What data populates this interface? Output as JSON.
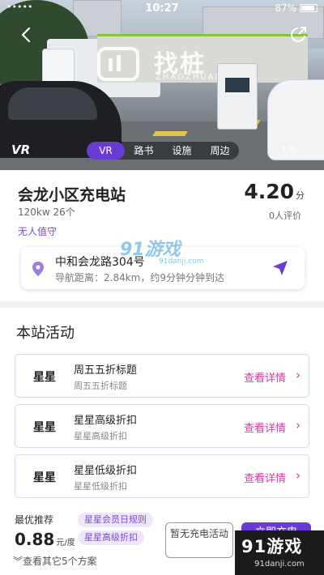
{
  "status_bar": {
    "carrier": "•••••",
    "time": "10:27",
    "battery": "87%"
  },
  "hero": {
    "banner_text": "找桩",
    "banner_sub": "ZHAOZHUANG",
    "vr_logo": "VR",
    "tabs": [
      {
        "label": "VR",
        "active": true
      },
      {
        "label": "路书",
        "active": false
      },
      {
        "label": "设施",
        "active": false
      },
      {
        "label": "周边",
        "active": false
      }
    ],
    "photo_count": "1/6",
    "icons": {
      "back": "back-arrow-icon",
      "share": "share-icon"
    }
  },
  "station": {
    "name": "会龙小区充电站",
    "spec": "120kw 26个",
    "tag": "无人值守",
    "score": "4.20",
    "score_unit": "分",
    "rating_count": "0人评价",
    "address": "中和会龙路304号",
    "nav_info": "导航距离：2.84km，约9分钟分钟到达"
  },
  "watermark": {
    "main": "91游戏",
    "sub": "91danji.com"
  },
  "activities": {
    "title": "本站活动",
    "items": [
      {
        "store": "星星",
        "title": "周五五折标题",
        "subtitle": "周五五折标题",
        "link": "查看详情"
      },
      {
        "store": "星星",
        "title": "星星高级折扣",
        "subtitle": "星星高级折扣",
        "link": "查看详情"
      },
      {
        "store": "星星",
        "title": "星星低级折扣",
        "subtitle": "星星低级折扣",
        "link": "查看详情"
      }
    ]
  },
  "bottom": {
    "recommend_label": "最优推荐",
    "price": "0.88",
    "price_unit": "元/度",
    "chips": [
      "星星会员日规则",
      "星星高级折扣"
    ],
    "more_plans": "查看其它5个方案",
    "btn_secondary": "暂无充电活动",
    "btn_primary": "立即充电"
  },
  "corner_logo": {
    "main": "91游戏",
    "sub": "91danji.com"
  },
  "colors": {
    "accent": "#6a3bd2",
    "link": "#d83ba2",
    "tag": "#7b4bd6"
  }
}
